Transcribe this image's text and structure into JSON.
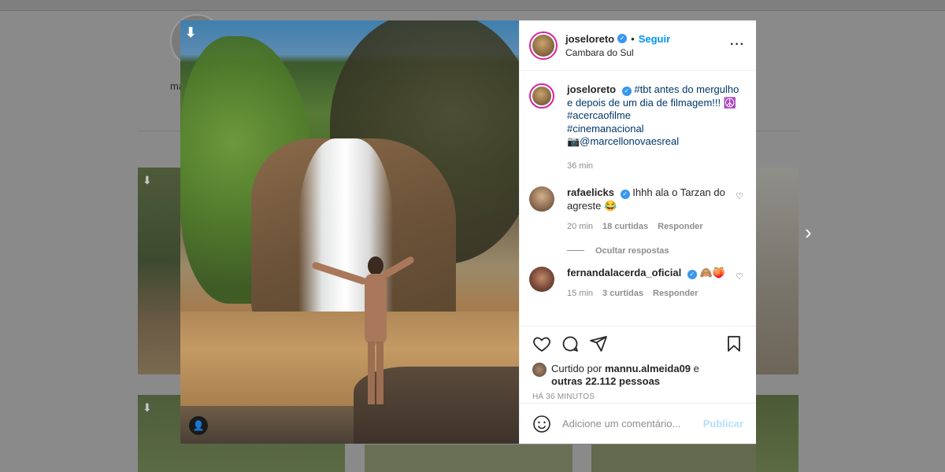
{
  "background": {
    "story_label": "ma"
  },
  "post": {
    "username": "joseloreto",
    "follow_label": "Seguir",
    "separator": "•",
    "location": "Cambara do Sul",
    "more_icon": "more-horizontal-icon",
    "verified_color": "#3897f0",
    "caption": {
      "username": "joseloreto",
      "text": "#tbt antes do mergulho e depois de um dia de filmagem!!! ☮️",
      "hashtag1": "#acercaofilme",
      "hashtag2": "#cinemanacional",
      "credit": "📷@marcellonovaesreal",
      "time": "36 min"
    },
    "comments": [
      {
        "username": "rafaelicks",
        "text": "Ihhh ala o Tarzan do agreste 😂",
        "time": "20 min",
        "likes": "18 curtidas",
        "reply": "Responder"
      },
      {
        "username": "fernandalacerda_oficial",
        "text": "🙈🍑",
        "time": "15 min",
        "likes": "3 curtidas",
        "reply": "Responder"
      }
    ],
    "hide_replies": "Ocultar respostas",
    "liked_by_prefix": "Curtido por",
    "liked_by_user": "mannu.almeida09",
    "liked_by_and": "e",
    "liked_by_others": "outras 22.112 pessoas",
    "time_ago": "HÁ 36 MINUTOS",
    "comment_placeholder": "Adicione um comentário...",
    "publish_label": "Publicar",
    "publish_color": "#b2dffc"
  }
}
